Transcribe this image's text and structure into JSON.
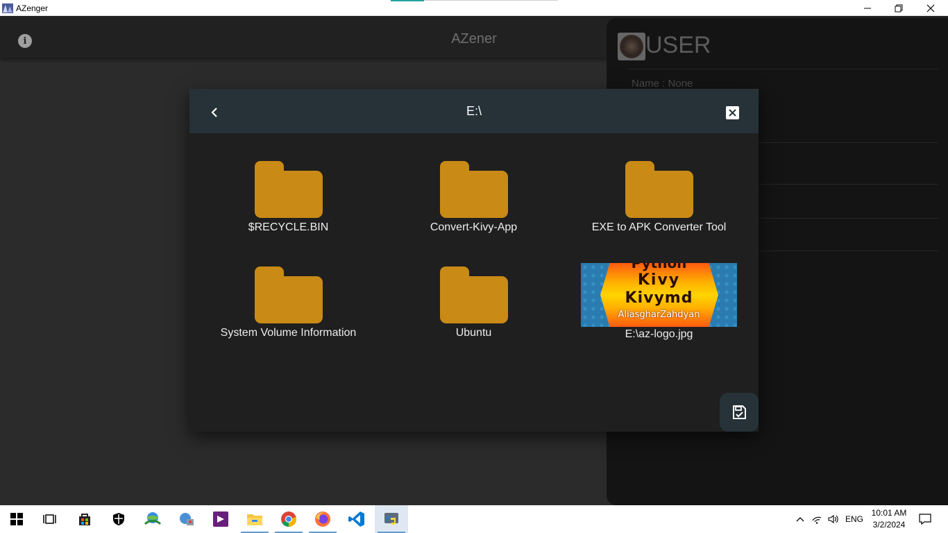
{
  "window": {
    "title": "AZenger"
  },
  "appbar": {
    "title": "AZener"
  },
  "drawer": {
    "user_title": "USER",
    "name_line": "Name : None"
  },
  "dialog": {
    "path": "E:\\",
    "items": [
      {
        "label": "$RECYCLE.BIN",
        "kind": "folder"
      },
      {
        "label": "Convert-Kivy-App",
        "kind": "folder"
      },
      {
        "label": "EXE to APK Converter Tool",
        "kind": "folder"
      },
      {
        "label": "System Volume Information",
        "kind": "folder"
      },
      {
        "label": "Ubuntu",
        "kind": "folder"
      },
      {
        "label": "E:\\az-logo.jpg",
        "kind": "image"
      }
    ],
    "thumbnail_text": {
      "line1": "Python",
      "line2": "Kivy",
      "line3": "Kivymd",
      "line4": "AliasgharZahdyan"
    }
  },
  "taskbar": {
    "apps": [
      "start-icon",
      "task-view-icon",
      "store-icon",
      "security-icon",
      "idm-icon",
      "network-app-icon",
      "visual-studio-icon",
      "file-explorer-icon",
      "chrome-icon",
      "firefox-icon",
      "vscode-icon",
      "python-icon"
    ],
    "language": "ENG",
    "time": "10:01 AM",
    "date": "3/2/2024"
  },
  "colors": {
    "folder": "#c98a16",
    "dialog_header": "#263238",
    "drawer": "#141414",
    "appbar": "#212121"
  }
}
